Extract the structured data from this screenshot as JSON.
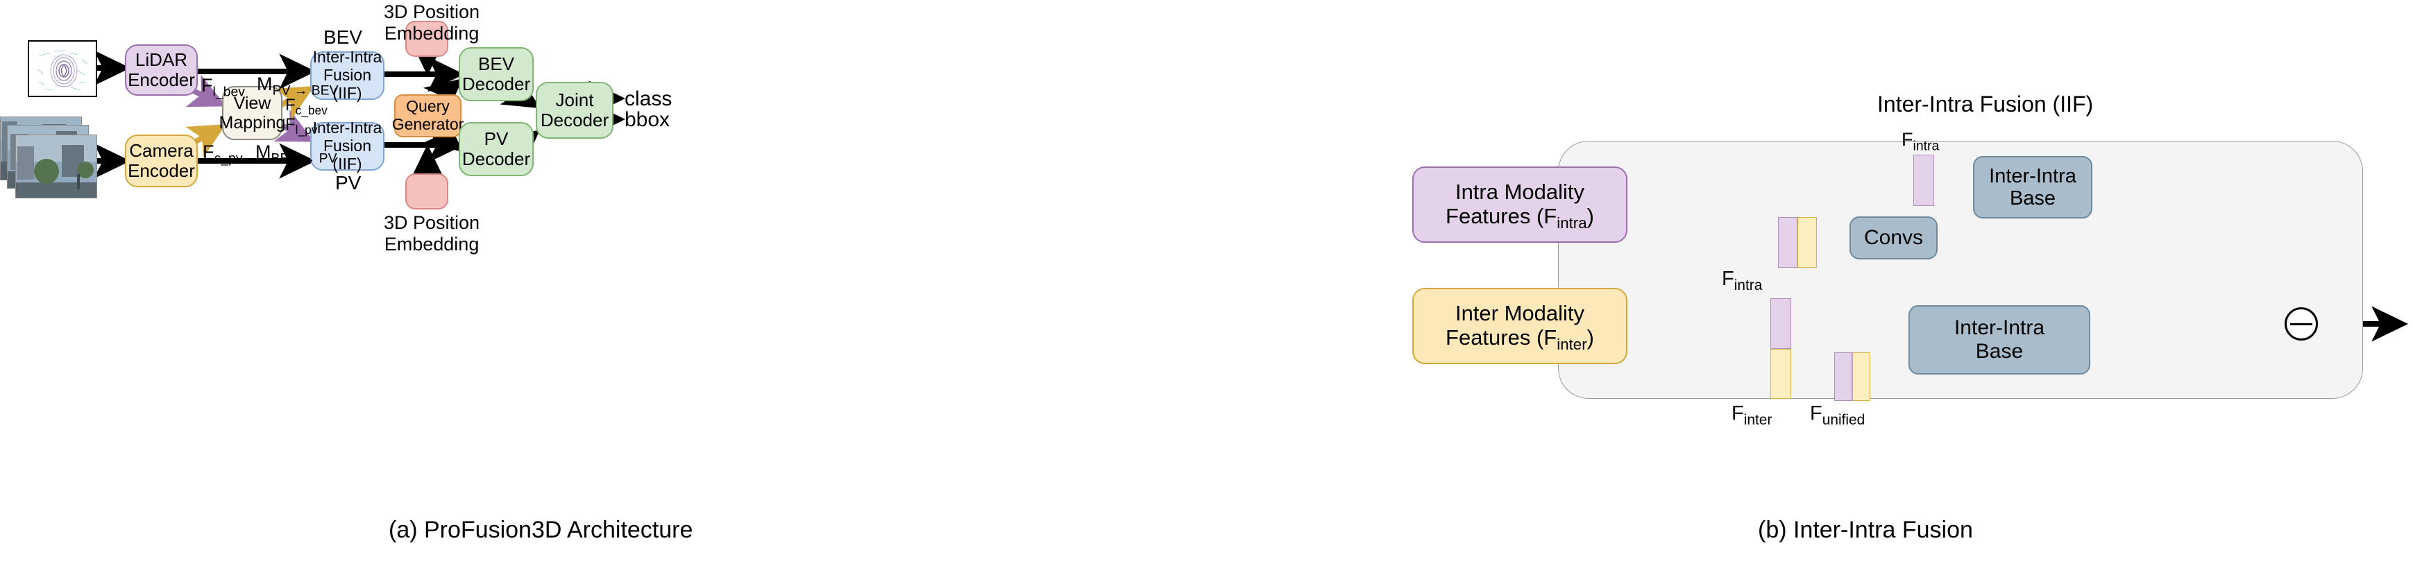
{
  "figure": {
    "caption_a": "(a) ProFusion3D Architecture",
    "caption_b": "(b) Inter-Intra Fusion"
  },
  "panel_a": {
    "inputs": {
      "lidar_image_name": "lidar-bev-point-cloud",
      "camera_image_name": "multi-camera-image-stack"
    },
    "blocks": {
      "lidar_encoder": "LiDAR\nEncoder",
      "lidar_encoder_l1": "LiDAR",
      "lidar_encoder_l2": "Encoder",
      "camera_encoder_l1": "Camera",
      "camera_encoder_l2": "Encoder",
      "view_mapping_l1": "View",
      "view_mapping_l2": "Mapping",
      "iif_bev_l1": "Inter-Intra",
      "iif_bev_l2": "Fusion (IIF)",
      "iif_pv_l1": "Inter-Intra",
      "iif_pv_l2": "Fusion (IIF)",
      "query_generator_l1": "Query",
      "query_generator_l2": "Generator",
      "bev_decoder_l1": "BEV",
      "bev_decoder_l2": "Decoder",
      "pv_decoder_l1": "PV",
      "pv_decoder_l2": "Decoder",
      "joint_decoder_l1": "Joint",
      "joint_decoder_l2": "Decoder"
    },
    "labels": {
      "bev_view": "BEV",
      "pv_view": "PV",
      "pe_top_l1": "3D Position",
      "pe_top_l2": "Embedding",
      "pe_bottom_l1": "3D Position",
      "pe_bottom_l2": "Embedding",
      "f_l_bev_base": "F",
      "f_l_bev_sub": "l_bev",
      "m_pv_bev_base": "M",
      "m_pv_bev_sub": "PV → BEV",
      "f_c_bev_base": "F",
      "f_c_bev_sub": "c_bev",
      "f_l_pv_base": "F",
      "f_l_pv_sub": "l_pv",
      "f_c_pv_base": "F",
      "f_c_pv_sub": "c_pv",
      "m_bev_pv_base": "M",
      "m_bev_pv_sub": "BEV → PV",
      "out_class": "class",
      "out_bbox": "bbox"
    }
  },
  "panel_b": {
    "title": "Inter-Intra Fusion (IIF)",
    "blocks": {
      "intra_feat_l1": "Intra Modality",
      "intra_feat_l2_base": "Features (F",
      "intra_feat_l2_sub": "intra",
      "intra_feat_l2_tail": ")",
      "inter_feat_l1": "Inter Modality",
      "inter_feat_l2_base": "Features (F",
      "inter_feat_l2_sub": "inter",
      "inter_feat_l2_tail": ")",
      "convs": "Convs",
      "iib_top_l1": "Inter-Intra",
      "iib_top_l2": "Base",
      "iib_bottom_l1": "Inter-Intra",
      "iib_bottom_l2": "Base"
    },
    "labels": {
      "f_intra_top_base": "F",
      "f_intra_top_sub": "intra",
      "f_intra_left_base": "F",
      "f_intra_left_sub": "intra",
      "f_inter_base": "F",
      "f_inter_sub": "inter",
      "f_unified_base": "F",
      "f_unified_sub": "unified",
      "merge_op": "subtract-circle-operator"
    }
  },
  "colors": {
    "lidar_fill": "#e3d2ea",
    "camera_fill": "#fce8b9",
    "viewmap_fill": "#f7f3e8",
    "iif_fill": "#d6e4f7",
    "decoder_fill": "#d3e9cd",
    "query_fill": "#fbc08a",
    "pos_embed_fill": "#f5c1bf",
    "iif_base_fill": "#a8bccc",
    "panel_b_bg": "#f4f4f4",
    "purple_arrow": "#9b6fae",
    "yellow_arrow": "#d6a73a"
  }
}
